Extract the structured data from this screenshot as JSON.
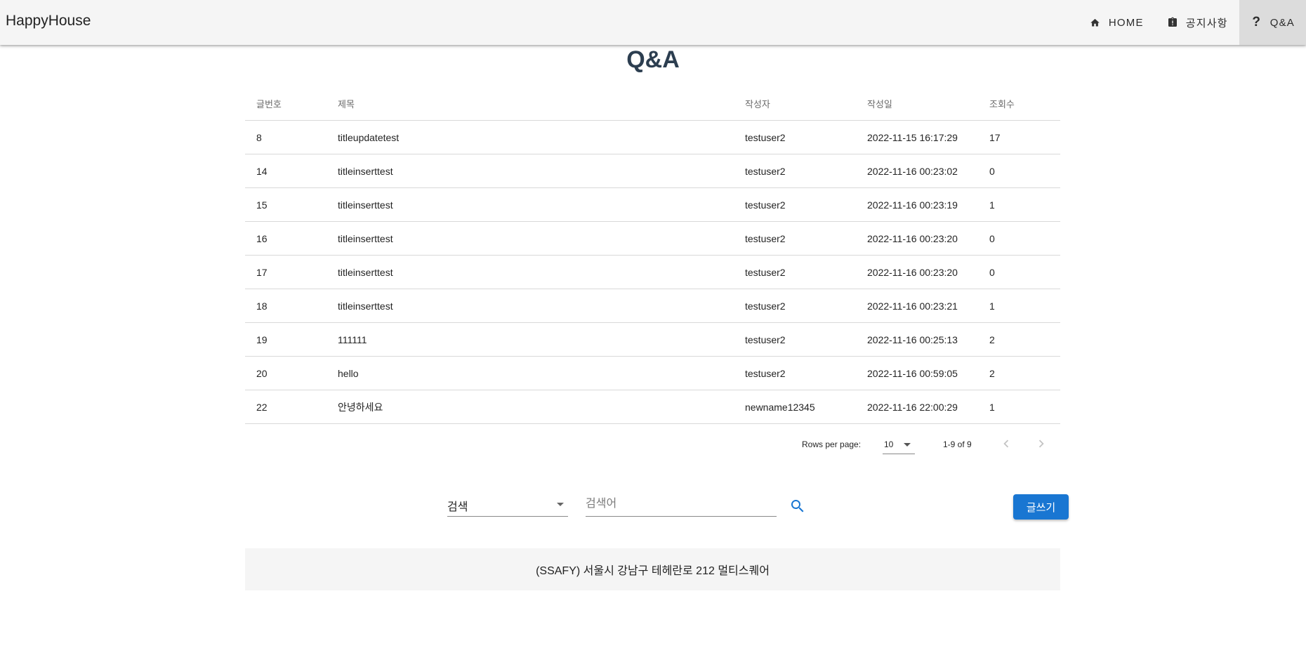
{
  "app": {
    "brand": "HappyHouse"
  },
  "nav": {
    "home": "HOME",
    "notice": "공지사항",
    "qna": "Q&A"
  },
  "page": {
    "title": "Q&A"
  },
  "table": {
    "headers": [
      "글번호",
      "제목",
      "작성자",
      "작성일",
      "조회수"
    ],
    "rows": [
      [
        "8",
        "titleupdatetest",
        "testuser2",
        "2022-11-15 16:17:29",
        "17"
      ],
      [
        "14",
        "titleinserttest",
        "testuser2",
        "2022-11-16 00:23:02",
        "0"
      ],
      [
        "15",
        "titleinserttest",
        "testuser2",
        "2022-11-16 00:23:19",
        "1"
      ],
      [
        "16",
        "titleinserttest",
        "testuser2",
        "2022-11-16 00:23:20",
        "0"
      ],
      [
        "17",
        "titleinserttest",
        "testuser2",
        "2022-11-16 00:23:20",
        "0"
      ],
      [
        "18",
        "titleinserttest",
        "testuser2",
        "2022-11-16 00:23:21",
        "1"
      ],
      [
        "19",
        "111111",
        "testuser2",
        "2022-11-16 00:25:13",
        "2"
      ],
      [
        "20",
        "hello",
        "testuser2",
        "2022-11-16 00:59:05",
        "2"
      ],
      [
        "22",
        "안녕하세요",
        "newname12345",
        "2022-11-16 22:00:29",
        "1"
      ]
    ],
    "footer": {
      "rows_per_page_label": "Rows per page:",
      "rows_per_page_value": "10",
      "range": "1-9 of 9"
    }
  },
  "search": {
    "select_value": "검색",
    "input_placeholder": "검색어",
    "input_value": ""
  },
  "actions": {
    "write_label": "글쓰기"
  },
  "site_footer": {
    "text": "(SSAFY) 서울시 강남구 테헤란로 212 멀티스퀘어"
  },
  "icons": {
    "home": "home-icon",
    "notice": "clipboard-alert-icon",
    "qna": "question-mark-icon",
    "search": "magnify-icon",
    "prev": "chevron-left-icon",
    "next": "chevron-right-icon",
    "dropdown": "menu-down-icon"
  },
  "colors": {
    "appbar": "#f5f5f5",
    "title": "#2c3e50",
    "primary": "#1976d2",
    "active_nav": "#dcdcdc",
    "footer": "#f5f5f5"
  }
}
